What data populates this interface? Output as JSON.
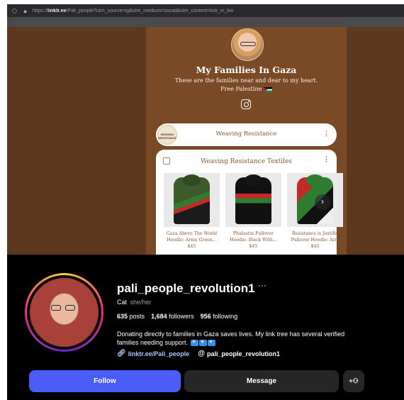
{
  "browser": {
    "url_prefix": "https://",
    "url_domain": "linktr.ee",
    "url_rest": "/Pali_people?utm_source=ig&utm_medium=social&utm_content=link_in_bio"
  },
  "linktree": {
    "title": "My Families In Gaza",
    "description": "These are the families near and dear to my heart. Free Palestine",
    "link1": {
      "thumb_text": "WEAVING RESISTANCE",
      "label": "Weaving Resistance",
      "more": "⋮"
    },
    "card": {
      "title": "Weaving Resistance Textiles",
      "more": "⋮",
      "next": "›",
      "products": [
        {
          "name_line1": "Gaza Above The World",
          "name_line2": "Hoodie: Army Green...",
          "price": "$45"
        },
        {
          "name_line1": "Phalastin Pullover",
          "name_line2": "Hoodie: Black With...",
          "price": "$45"
        },
        {
          "name_line1": "Resistance is Justifie",
          "name_line2": "Pullover Hoodie: Arm",
          "price": "$45"
        }
      ]
    }
  },
  "instagram": {
    "username": "pali_people_revolution1",
    "more": "···",
    "category": "Cat",
    "pronouns": "she/her",
    "posts_count": "635",
    "posts_label": "posts",
    "followers_count": "1,684",
    "followers_label": "followers",
    "following_count": "956",
    "following_label": "following",
    "bio_line1": "Donating directly to families in Gaza saves lives. My link tree has several verified",
    "bio_line2": "families needing support.",
    "link_text": "linktr.ee/Pali_people",
    "threads_handle": "pali_people_revolution1",
    "follow_label": "Follow",
    "message_label": "Message",
    "add_user_label": "+⚇"
  }
}
